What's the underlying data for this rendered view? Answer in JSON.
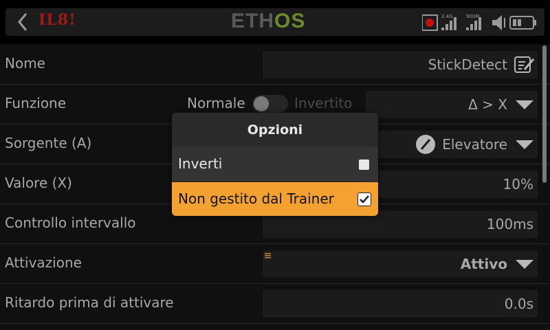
{
  "header": {
    "model_name": "IL8!",
    "logo_left": "ETH",
    "logo_right": "OS",
    "status": {
      "band_label": "2.4G",
      "module_label": "900M"
    }
  },
  "rows": [
    {
      "label": "Nome",
      "value": "StickDetect"
    },
    {
      "label": "Funzione",
      "normal": "Normale",
      "inverted": "Invertito",
      "value": "Δ > X"
    },
    {
      "label": "Sorgente (A)",
      "value": "Elevatore"
    },
    {
      "label": "Valore (X)",
      "value": "10%"
    },
    {
      "label": "Controllo intervallo",
      "value": "100ms"
    },
    {
      "label": "Attivazione",
      "value": "Attivo"
    },
    {
      "label": "Ritardo prima di attivare",
      "value": "0.0s"
    }
  ],
  "dialog": {
    "title": "Opzioni",
    "options": [
      {
        "label": "Inverti",
        "checked": false
      },
      {
        "label": "Non gestito dal Trainer",
        "checked": true
      }
    ]
  },
  "colors": {
    "accent": "#f3a232",
    "model_name": "#a01818",
    "logo_os": "#6e8a2a"
  }
}
